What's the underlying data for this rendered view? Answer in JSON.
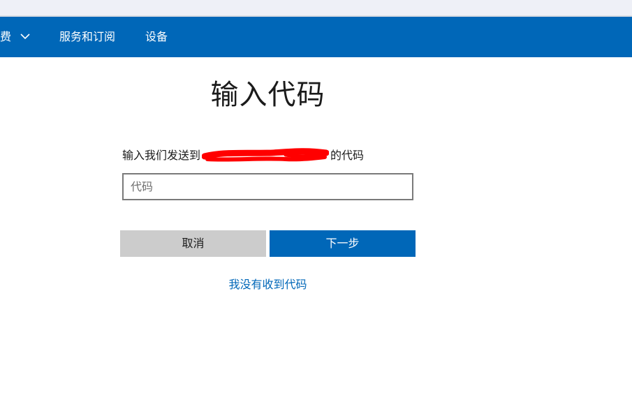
{
  "nav": {
    "items": [
      {
        "label": "费",
        "has_dropdown": true,
        "dropdown_icon": "chevron-down-icon"
      },
      {
        "label": "服务和订阅"
      },
      {
        "label": "设备"
      }
    ]
  },
  "main": {
    "title": "输入代码",
    "instruction_prefix": "输入我们发送到",
    "instruction_suffix": "的代码",
    "code_input": {
      "placeholder": "代码",
      "value": ""
    },
    "cancel_label": "取消",
    "next_label": "下一步",
    "resend_link": "我没有收到代码"
  },
  "colors": {
    "accent": "#0067b8",
    "cancel_bg": "#cccccc",
    "redaction": "#ff0000",
    "top_strip": "#eef0f7"
  }
}
